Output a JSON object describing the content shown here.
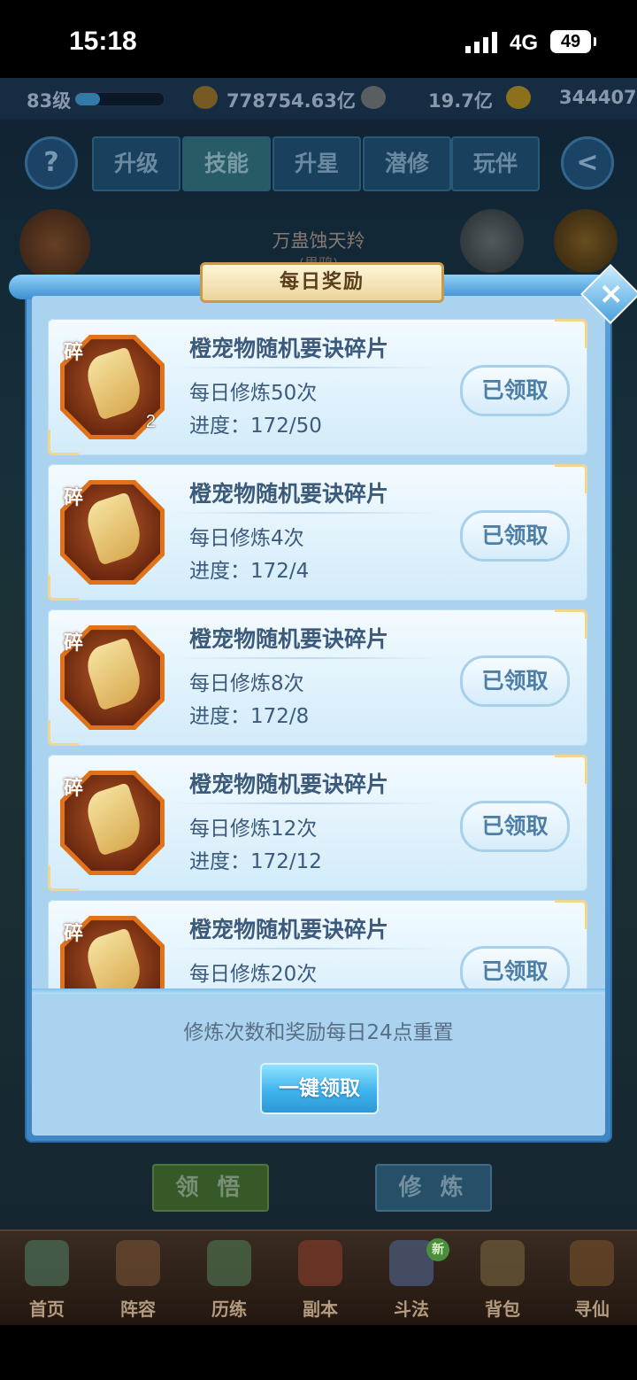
{
  "status_bar": {
    "time": "15:18",
    "network": "4G",
    "battery": "49"
  },
  "game": {
    "level": "83级",
    "power": "778754.63亿",
    "silver": "19.7亿",
    "gold": "344407",
    "help_icon": "?",
    "back_icon": "<",
    "tabs": [
      "升级",
      "技能",
      "升星",
      "潜修",
      "玩伴"
    ],
    "boss_name": "万蛊蚀天羚",
    "boss_sub": "(果鸦)",
    "bottom_buttons": {
      "comprehend": "领 悟",
      "cultivate": "修 炼"
    },
    "nav": [
      "首页",
      "阵容",
      "历练",
      "副本",
      "斗法",
      "背包",
      "寻仙"
    ],
    "nav_badge": "新"
  },
  "dialog": {
    "title": "每日奖励",
    "close_icon": "×",
    "item_tag": "碎",
    "rewards": [
      {
        "name": "橙宠物随机要诀碎片",
        "requirement": "每日修炼50次",
        "progress": "进度：172/50",
        "qty": "2",
        "button": "已领取"
      },
      {
        "name": "橙宠物随机要诀碎片",
        "requirement": "每日修炼4次",
        "progress": "进度：172/4",
        "qty": "",
        "button": "已领取"
      },
      {
        "name": "橙宠物随机要诀碎片",
        "requirement": "每日修炼8次",
        "progress": "进度：172/8",
        "qty": "",
        "button": "已领取"
      },
      {
        "name": "橙宠物随机要诀碎片",
        "requirement": "每日修炼12次",
        "progress": "进度：172/12",
        "qty": "",
        "button": "已领取"
      },
      {
        "name": "橙宠物随机要诀碎片",
        "requirement": "每日修炼20次",
        "progress": "",
        "qty": "",
        "button": "已领取"
      }
    ],
    "reset_note": "修炼次数和奖励每日24点重置",
    "claim_all": "一键领取"
  }
}
